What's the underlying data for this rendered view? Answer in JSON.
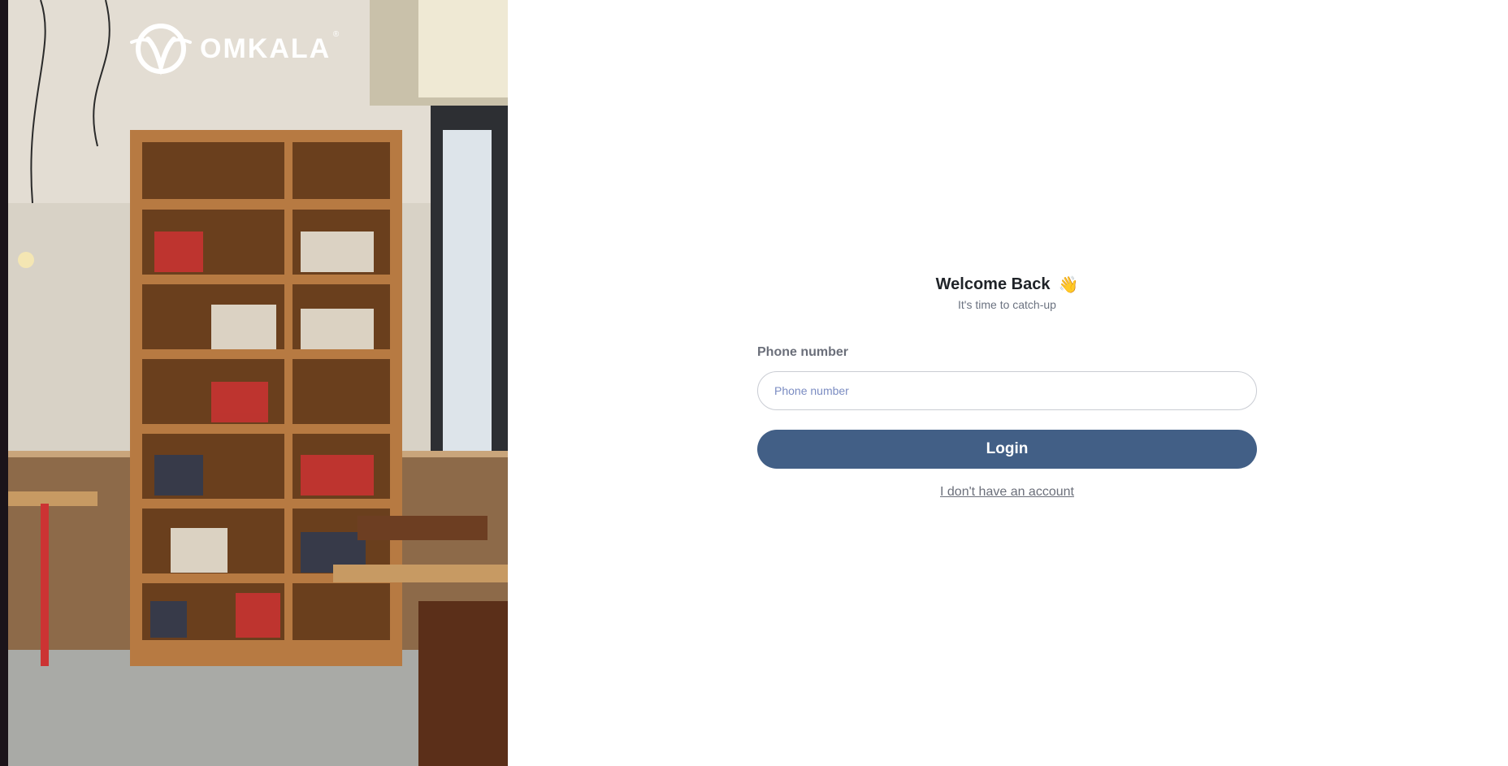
{
  "brand": {
    "name": "OMKALA",
    "reg_mark": "®",
    "logo_icon": "omkala-logo-icon"
  },
  "hero": {
    "image_subject": "bookshelf cafe interior"
  },
  "form": {
    "title": "Welcome Back",
    "title_emoji": "👋",
    "subtitle": "It's time to catch-up",
    "phone_label": "Phone number",
    "phone_placeholder": "Phone number",
    "phone_value": "",
    "login_label": "Login",
    "signup_link": "I don't have an account"
  },
  "colors": {
    "primary_button": "#425f86",
    "placeholder": "#7b8cc2",
    "label": "#6b6f7a"
  }
}
